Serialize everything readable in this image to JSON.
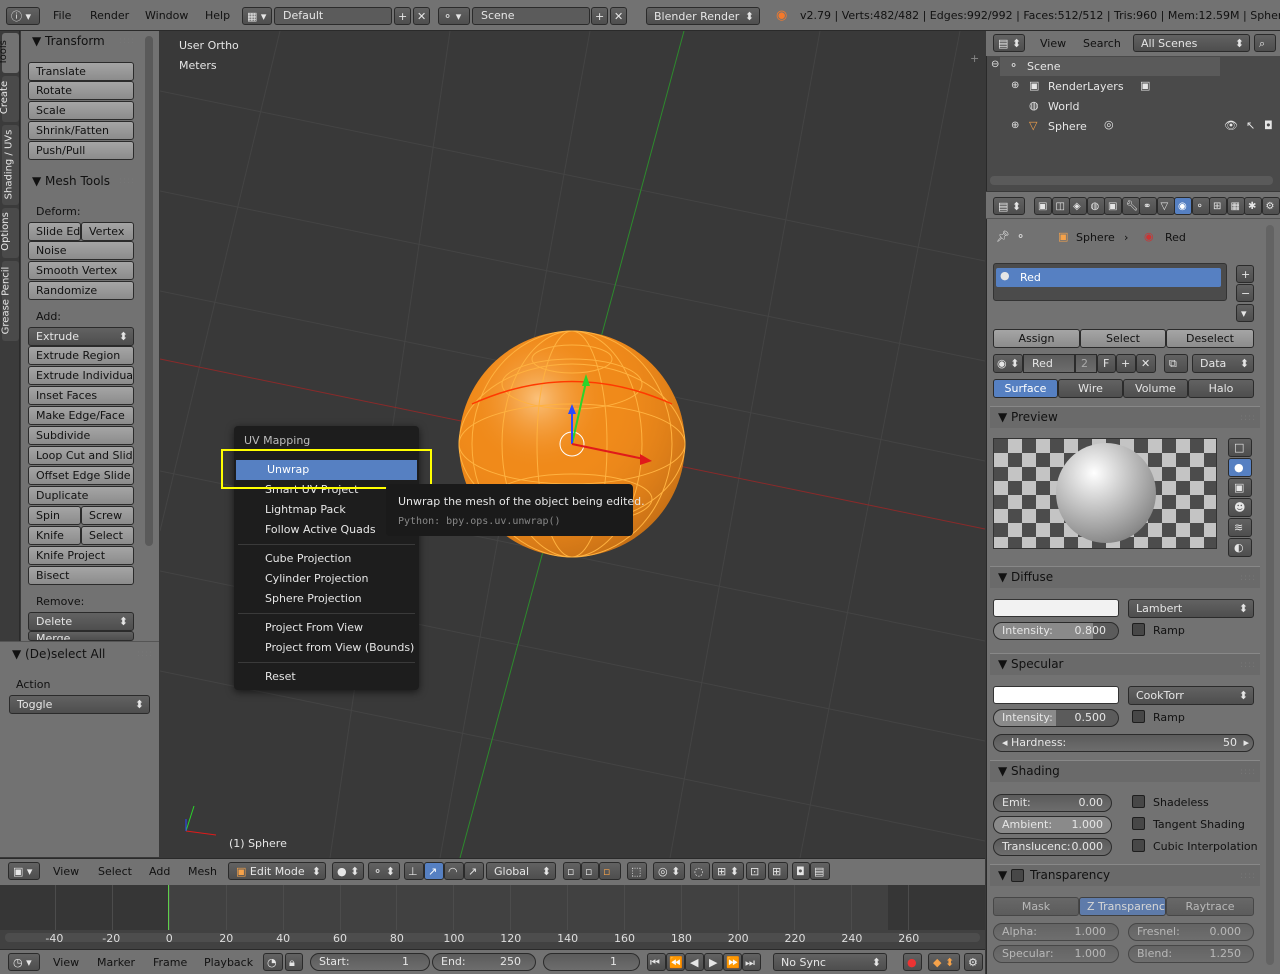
{
  "topbar": {
    "menus": [
      "File",
      "Render",
      "Window",
      "Help"
    ],
    "layout": "Default",
    "scene": "Scene",
    "engine": "Blender Render",
    "stats": "v2.79 | Verts:482/482 | Edges:992/992 | Faces:512/512 | Tris:960 | Mem:12.59M | Sphere"
  },
  "left_tabs": [
    "Tools",
    "Create",
    "Shading / UVs",
    "Options",
    "Grease Pencil"
  ],
  "tools": {
    "transform_title": "Transform",
    "transform": [
      "Translate",
      "Rotate",
      "Scale",
      "Shrink/Fatten",
      "Push/Pull"
    ],
    "mesh_title": "Mesh Tools",
    "deform_label": "Deform:",
    "slide_edge": "Slide Ed",
    "vertex": "Vertex",
    "noise": "Noise",
    "smooth_vertex": "Smooth Vertex",
    "randomize": "Randomize",
    "add_label": "Add:",
    "extrude": "Extrude",
    "add": [
      "Extrude Region",
      "Extrude Individual",
      "Inset Faces",
      "Make Edge/Face",
      "Subdivide",
      "Loop Cut and Slide",
      "Offset Edge Slide",
      "Duplicate"
    ],
    "spin": "Spin",
    "screw": "Screw",
    "knife": "Knife",
    "select": "Select",
    "knife_project": "Knife Project",
    "bisect": "Bisect",
    "remove_label": "Remove:",
    "delete": "Delete",
    "merge": "Merge"
  },
  "operator": {
    "title": "(De)select All",
    "action_label": "Action",
    "action_value": "Toggle"
  },
  "viewport": {
    "view_name": "User Ortho",
    "units": "Meters",
    "object_label": "(1) Sphere"
  },
  "uv_menu": {
    "title": "UV Mapping",
    "items": [
      "Unwrap",
      "Smart UV Project",
      "Lightmap Pack",
      "Follow Active Quads",
      "Cube Projection",
      "Cylinder Projection",
      "Sphere Projection",
      "Project From View",
      "Project from View (Bounds)",
      "Reset"
    ]
  },
  "tooltip": {
    "text": "Unwrap the mesh of the object being edited.",
    "python": "Python: bpy.ops.uv.unwrap()"
  },
  "view_header": {
    "menus": [
      "View",
      "Select",
      "Add",
      "Mesh"
    ],
    "mode": "Edit Mode",
    "orientation": "Global"
  },
  "timeline": {
    "ticks": [
      "-40",
      "-20",
      "0",
      "20",
      "40",
      "60",
      "80",
      "100",
      "120",
      "140",
      "160",
      "180",
      "200",
      "220",
      "240",
      "260"
    ],
    "menus": [
      "View",
      "Marker",
      "Frame",
      "Playback"
    ],
    "start_label": "Start:",
    "start": "1",
    "end_label": "End:",
    "end": "250",
    "current": "1",
    "sync": "No Sync"
  },
  "outliner": {
    "view": "View",
    "search": "Search",
    "filter": "All Scenes",
    "items": [
      "Scene",
      "RenderLayers",
      "World",
      "Sphere"
    ]
  },
  "properties": {
    "breadcrumb": [
      "Sphere",
      "Red"
    ],
    "slot": "Red",
    "assign": "Assign",
    "select": "Select",
    "deselect": "Deselect",
    "material_name": "Red",
    "users": "2",
    "fake": "F",
    "link": "Data",
    "tabs": [
      "Surface",
      "Wire",
      "Volume",
      "Halo"
    ],
    "preview_title": "Preview",
    "diffuse_title": "Diffuse",
    "diffuse_shader": "Lambert",
    "diffuse_intensity_label": "Intensity:",
    "diffuse_intensity": "0.800",
    "ramp": "Ramp",
    "specular_title": "Specular",
    "specular_shader": "CookTorr",
    "specular_intensity_label": "Intensity:",
    "specular_intensity": "0.500",
    "hardness_label": "Hardness:",
    "hardness": "50",
    "shading_title": "Shading",
    "emit_label": "Emit:",
    "emit": "0.00",
    "ambient_label": "Ambient:",
    "ambient": "1.000",
    "transluc_label": "Translucenc:",
    "transluc": "0.000",
    "shadeless": "Shadeless",
    "tangent": "Tangent Shading",
    "cubic": "Cubic Interpolation",
    "transparency_title": "Transparency",
    "mask": "Mask",
    "ztrans": "Z Transparency",
    "raytrace": "Raytrace",
    "alpha_label": "Alpha:",
    "alpha": "1.000",
    "fresnel_label": "Fresnel:",
    "fresnel": "0.000",
    "spec_label": "Specular:",
    "spec": "1.000",
    "blend_label": "Blend:",
    "blend": "1.250"
  },
  "colors": {
    "accent": "#5680c2",
    "highlight": "#ffff00",
    "mesh": "#ff8a1a"
  }
}
